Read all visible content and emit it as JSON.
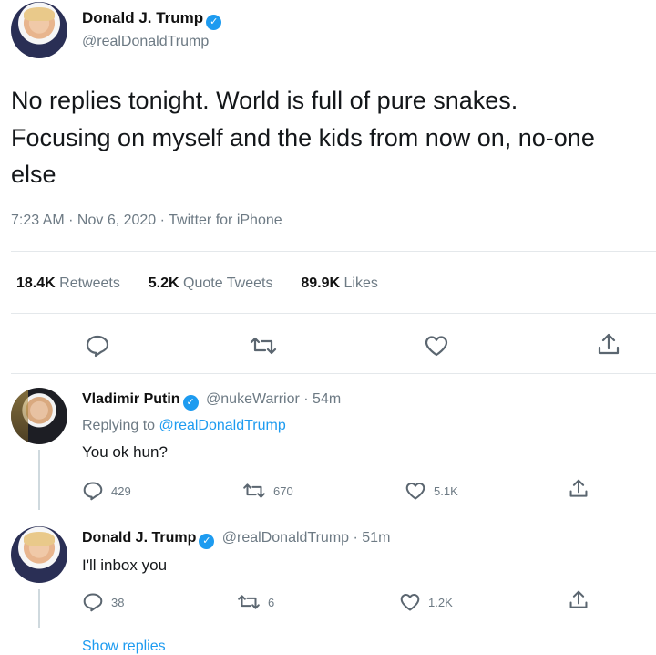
{
  "tweet": {
    "author_name": "Donald J. Trump",
    "author_handle": "@realDonaldTrump",
    "text_lines": [
      "No replies tonight. World is full of pure snakes.",
      "Focusing on myself and the kids from now on, no-one",
      "else"
    ],
    "meta": "7:23 AM · Nov 6, 2020 · Twitter for iPhone",
    "stats": {
      "retweets_count": "18.4K",
      "retweets_label": "Retweets",
      "quotes_count": "5.2K",
      "quotes_label": "Quote Tweets",
      "likes_count": "89.9K",
      "likes_label": "Likes"
    }
  },
  "replies": [
    {
      "name": "Vladimir Putin",
      "handle_time": "@nukeWarrior · 54m",
      "replying_prefix": "Replying to",
      "replying_to": "@realDonaldTrump",
      "text": "You ok hun?",
      "reply_count": "429",
      "retweet_count": "670",
      "like_count": "5.1K"
    },
    {
      "name": "Donald J. Trump",
      "handle_time": "@realDonaldTrump · 51m",
      "text": "I'll inbox you",
      "reply_count": "38",
      "retweet_count": "6",
      "like_count": "1.2K"
    }
  ],
  "show_replies": "Show replies"
}
